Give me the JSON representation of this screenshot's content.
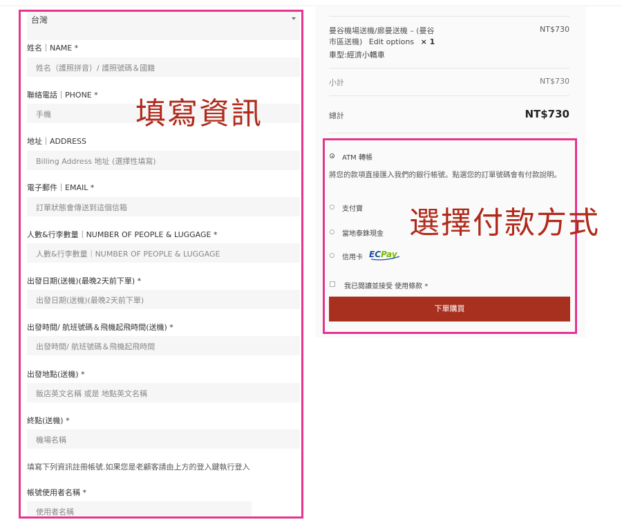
{
  "form": {
    "country_value": "台灣",
    "fields": [
      {
        "label": "姓名｜NAME *",
        "placeholder": "姓名（護照拼音）/ 護照號碼＆國籍"
      },
      {
        "label": "聯絡電話｜PHONE *",
        "placeholder": "手機"
      },
      {
        "label": "地址｜ADDRESS",
        "placeholder": "Billing Address 地址 (選擇性填寫)"
      },
      {
        "label": "電子郵件｜EMAIL *",
        "placeholder": "訂單狀態會傳送到這個信箱"
      },
      {
        "label": "人數&行李數量｜NUMBER OF PEOPLE & LUGGAGE *",
        "placeholder": "人數&行李數量｜NUMBER OF PEOPLE & LUGGAGE"
      },
      {
        "label": "出發日期(送機)(最晚2天前下單) *",
        "placeholder": "出發日期(送機)(最晚2天前下單)"
      },
      {
        "label": "出發時間/ 航班號碼＆飛機起飛時間(送機) *",
        "placeholder": "出發時間/ 航班號碼＆飛機起飛時間"
      },
      {
        "label": "出發地點(送機) *",
        "placeholder": "飯店英文名稱 或是 地點英文名稱"
      },
      {
        "label": "終點(送機) *",
        "placeholder": "機場名稱"
      }
    ],
    "register_note": "填寫下列資訊註冊帳號.如果您是老顧客請由上方的登入鍵執行登入",
    "username_label": "帳號使用者名稱 *",
    "username_placeholder": "使用者名稱"
  },
  "annotations": {
    "fill_info": "填寫資訊",
    "choose_payment": "選擇付款方式"
  },
  "summary": {
    "item_name_line1": "曼谷機場送機/廊曼送機 – (曼谷",
    "item_name_line2": "市區送機)",
    "edit_options": "Edit options",
    "quantity": "× 1",
    "item_price": "NT$730",
    "vehicle": "車型:經濟小轎車",
    "subtotal_label": "小計",
    "subtotal_value": "NT$730",
    "total_label": "總計",
    "total_value": "NT$730"
  },
  "payment": {
    "atm_label": "ATM 轉帳",
    "atm_desc": "將您的款項直接匯入我們的銀行帳號。點選您的訂單號碼會有付款說明。",
    "alipay_label": "支付寶",
    "thai_cash_label": "當地泰銖現金",
    "credit_label": "信用卡",
    "ecpay_text": "ECPay",
    "terms_label": "我已閱讀並接受 使用條款 *",
    "submit_label": "下單購買"
  },
  "colors": {
    "highlight_border": "#e5338f",
    "annotation_text": "#b02a1a",
    "submit_bg": "#a8301f",
    "ecpay_blue": "#1a4fa0",
    "ecpay_green": "#7ab800"
  }
}
